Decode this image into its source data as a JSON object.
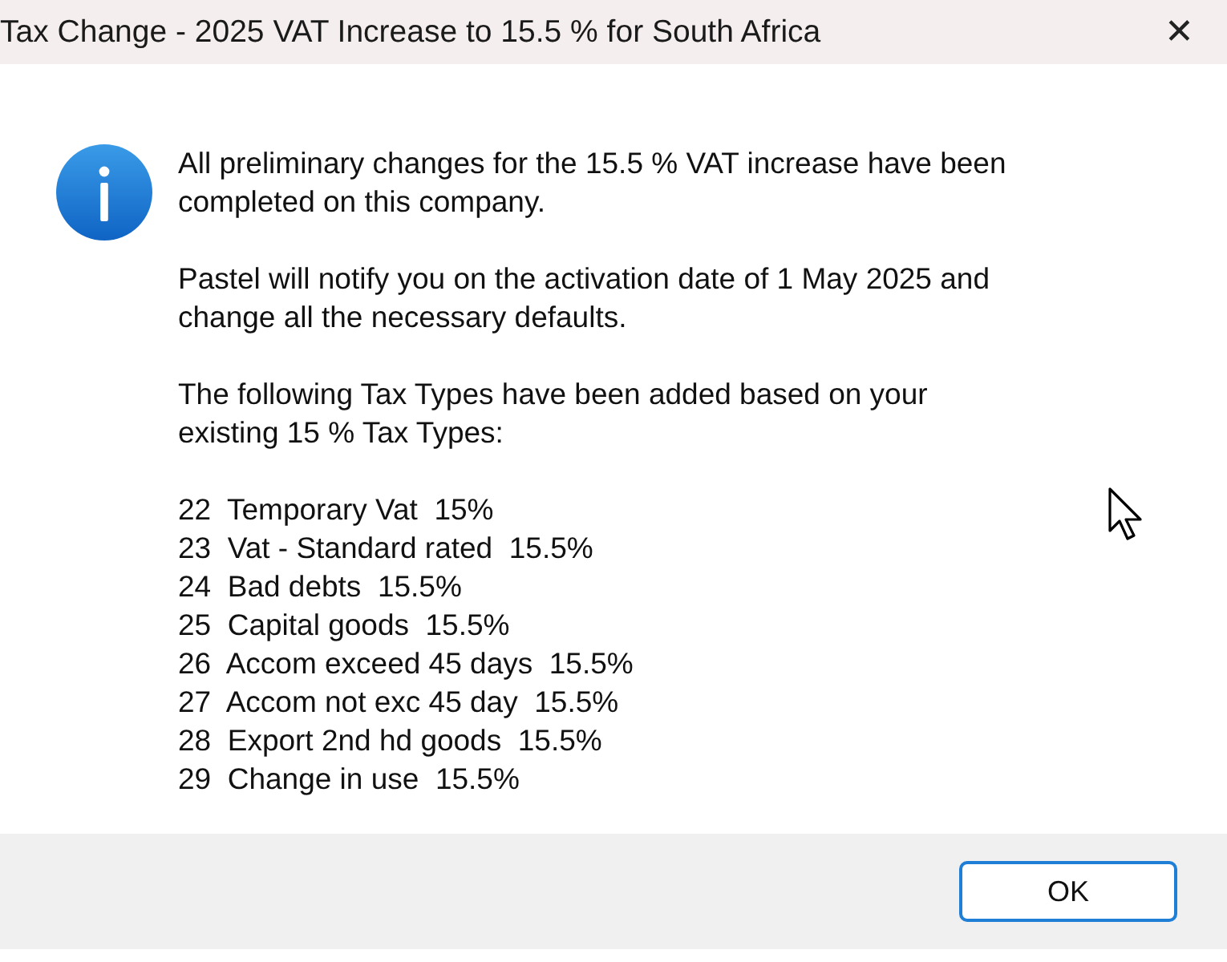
{
  "window": {
    "title": "Tax Change - 2025  VAT Increase to 15.5 % for South Africa",
    "close": "✕"
  },
  "message": {
    "paragraphs": [
      "All preliminary changes for the 15.5 % VAT increase have been\ncompleted on this company.",
      "Pastel will notify you on the activation date of 1 May 2025 and\nchange all the necessary defaults.",
      "The following Tax Types have been added based on your\nexisting 15 % Tax Types:"
    ],
    "tax_types": [
      "22  Temporary Vat  15%",
      "23  Vat - Standard rated  15.5%",
      "24  Bad debts  15.5%",
      "25  Capital goods  15.5%",
      "26  Accom exceed 45 days  15.5%",
      "27  Accom not exc 45 day  15.5%",
      "28  Export 2nd hd goods  15.5%",
      "29  Change in use  15.5%"
    ]
  },
  "buttons": [
    "OK"
  ]
}
